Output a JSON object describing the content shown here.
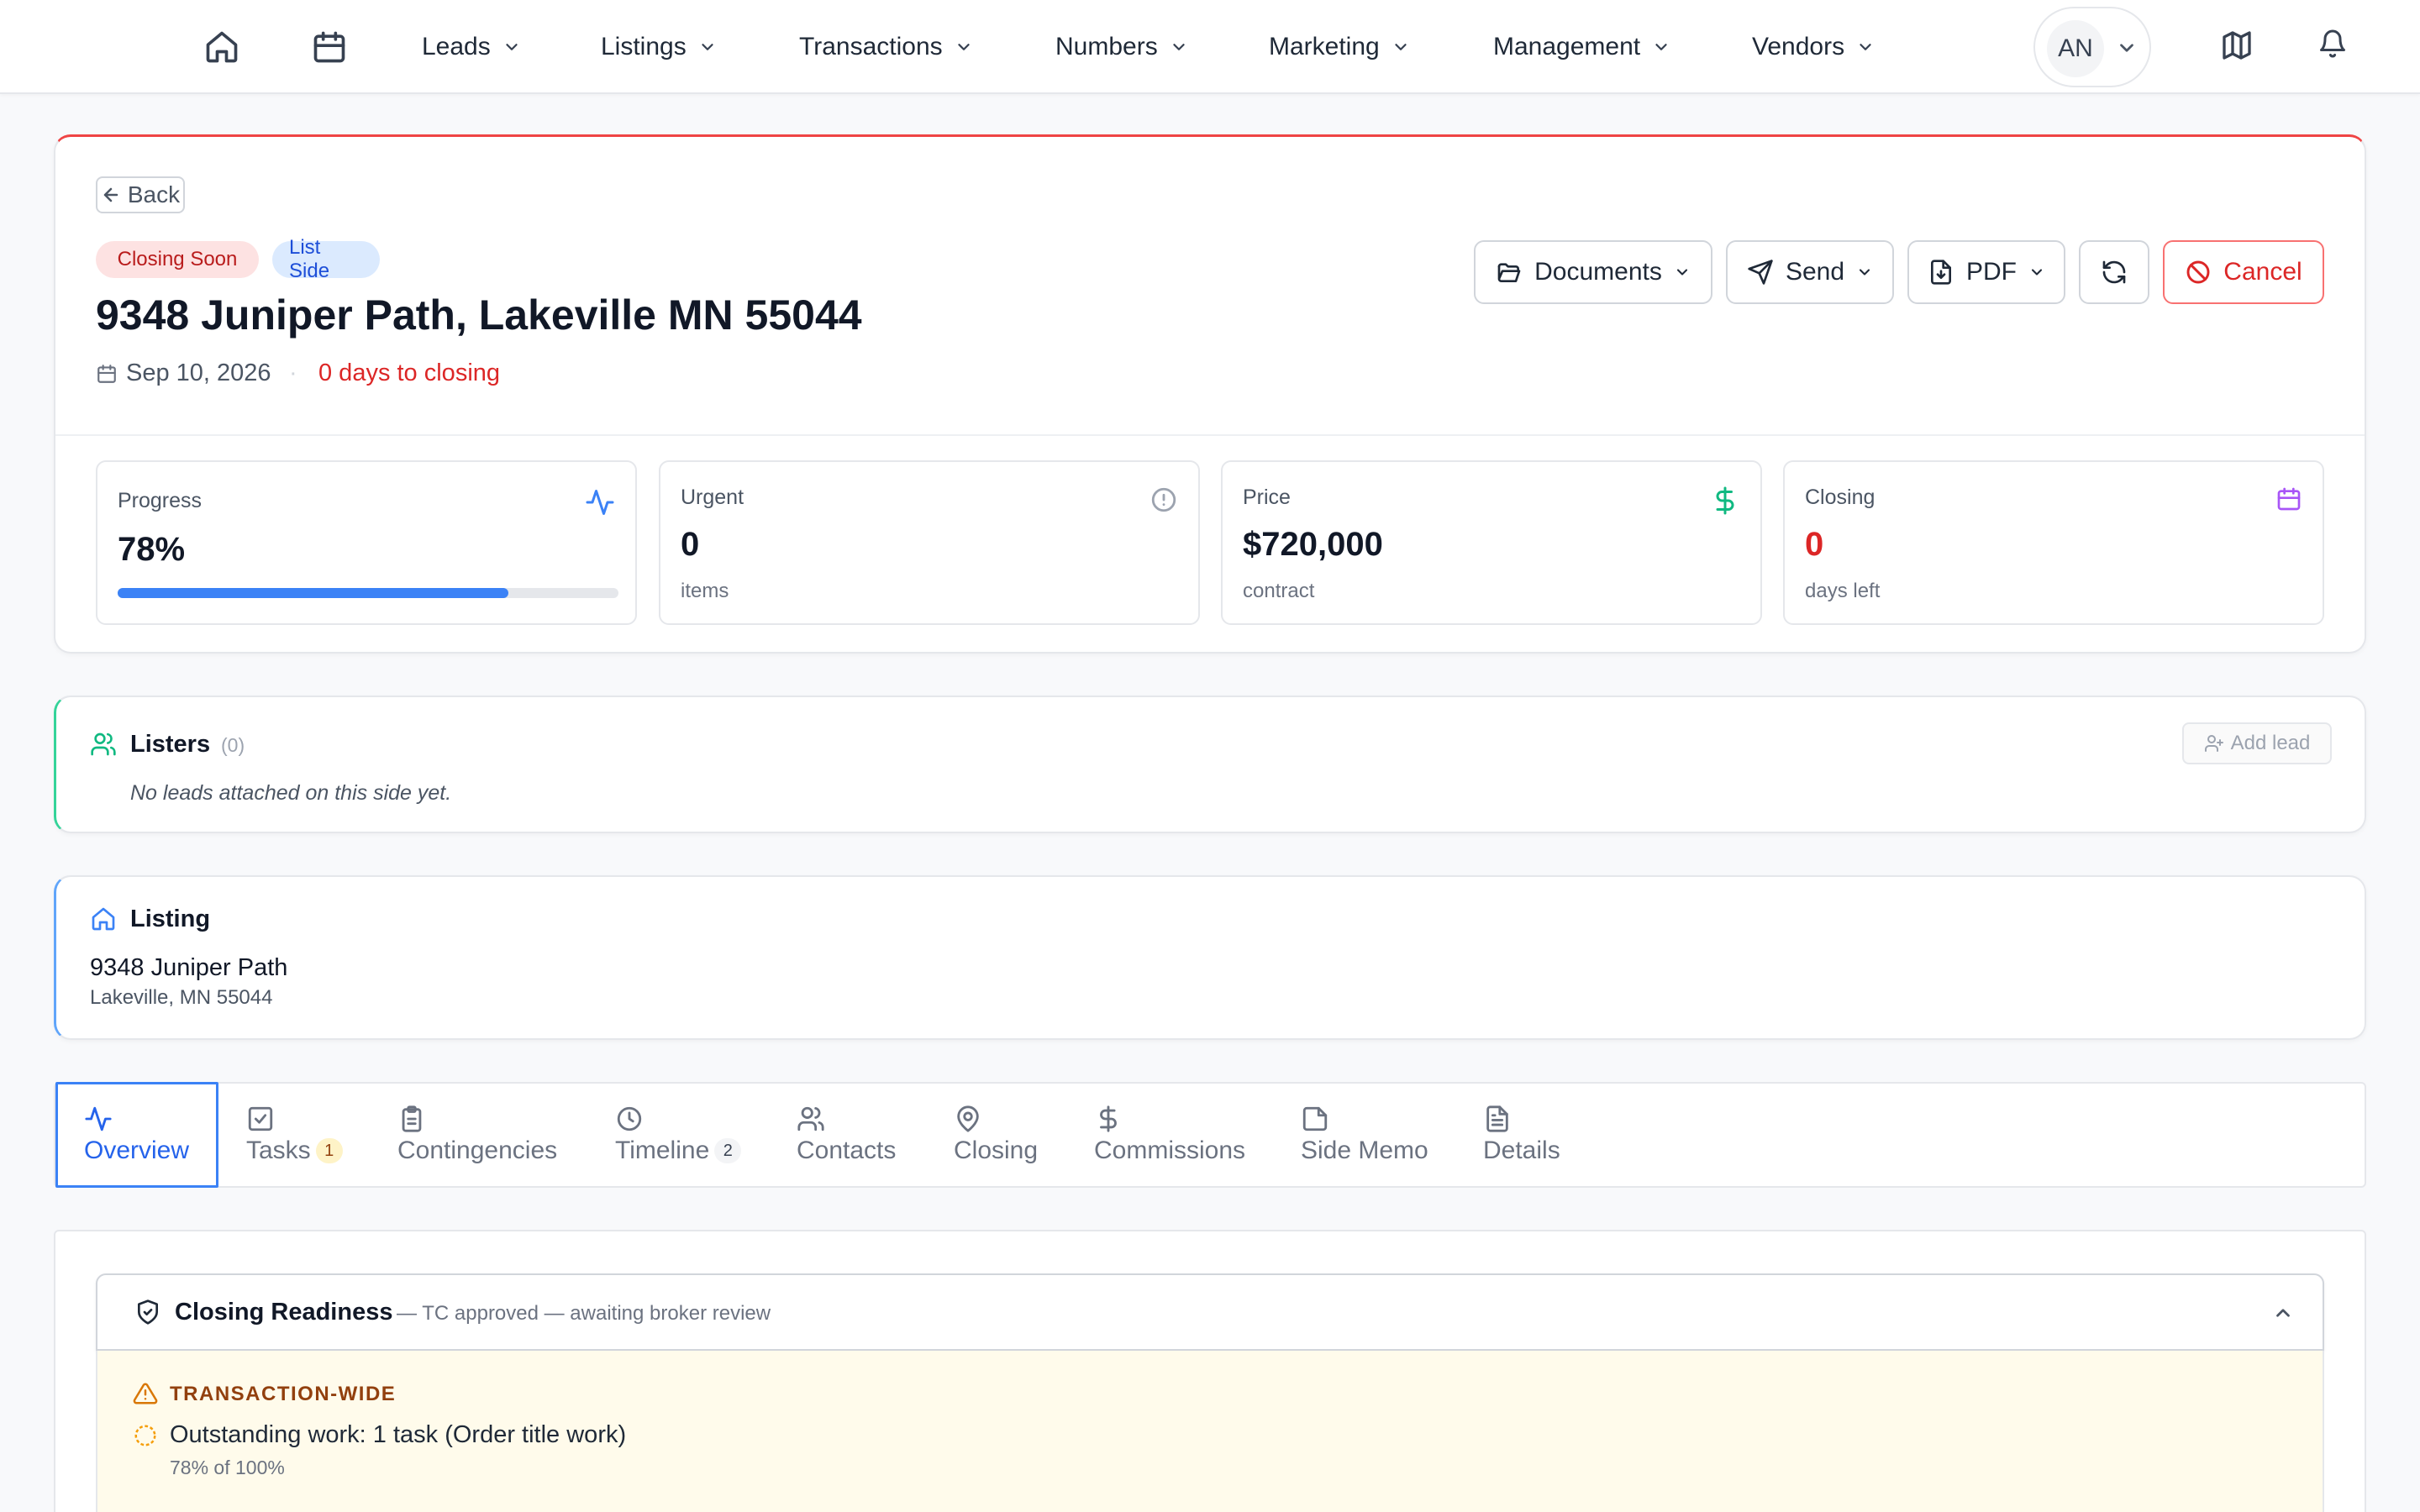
{
  "nav": {
    "items": [
      {
        "label": "Leads"
      },
      {
        "label": "Listings"
      },
      {
        "label": "Transactions"
      },
      {
        "label": "Numbers"
      },
      {
        "label": "Marketing"
      },
      {
        "label": "Management"
      },
      {
        "label": "Vendors"
      }
    ],
    "avatar_initials": "AN"
  },
  "header": {
    "back_label": "Back",
    "badges": [
      "Closing Soon",
      "List Side"
    ],
    "title": "9348 Juniper Path, Lakeville MN 55044",
    "date": "Sep 10, 2026",
    "separator": "·",
    "days_to_closing": "0 days to closing",
    "actions": {
      "documents": "Documents",
      "send": "Send",
      "pdf": "PDF",
      "cancel": "Cancel"
    }
  },
  "stats": {
    "progress": {
      "label": "Progress",
      "value": "78%",
      "fraction": 0.78
    },
    "urgent": {
      "label": "Urgent",
      "value": "0",
      "sub": "items"
    },
    "price": {
      "label": "Price",
      "value": "$720,000",
      "sub": "contract"
    },
    "closing": {
      "label": "Closing",
      "value": "0",
      "sub": "days left"
    }
  },
  "listers": {
    "title": "Listers",
    "count": "(0)",
    "empty": "No leads attached on this side yet.",
    "add_label": "Add lead"
  },
  "listing": {
    "title": "Listing",
    "street": "9348 Juniper Path",
    "city": "Lakeville, MN 55044"
  },
  "tabs": [
    {
      "label": "Overview",
      "count": ""
    },
    {
      "label": "Tasks",
      "count": "1"
    },
    {
      "label": "Contingencies",
      "count": ""
    },
    {
      "label": "Timeline",
      "count": "2"
    },
    {
      "label": "Contacts",
      "count": ""
    },
    {
      "label": "Closing",
      "count": ""
    },
    {
      "label": "Commissions",
      "count": ""
    },
    {
      "label": "Side Memo",
      "count": ""
    },
    {
      "label": "Details",
      "count": ""
    }
  ],
  "readiness": {
    "title": "Closing Readiness",
    "status": "— TC approved — awaiting broker review",
    "section_label": "TRANSACTION-WIDE",
    "item_text": "Outstanding work: 1 task (Order title work)",
    "item_sub": "78% of 100%"
  },
  "colors": {
    "accent_blue": "#3b82f6",
    "danger_red": "#dc2626",
    "green": "#10b981",
    "purple": "#a855f7",
    "amber": "#d97706"
  }
}
